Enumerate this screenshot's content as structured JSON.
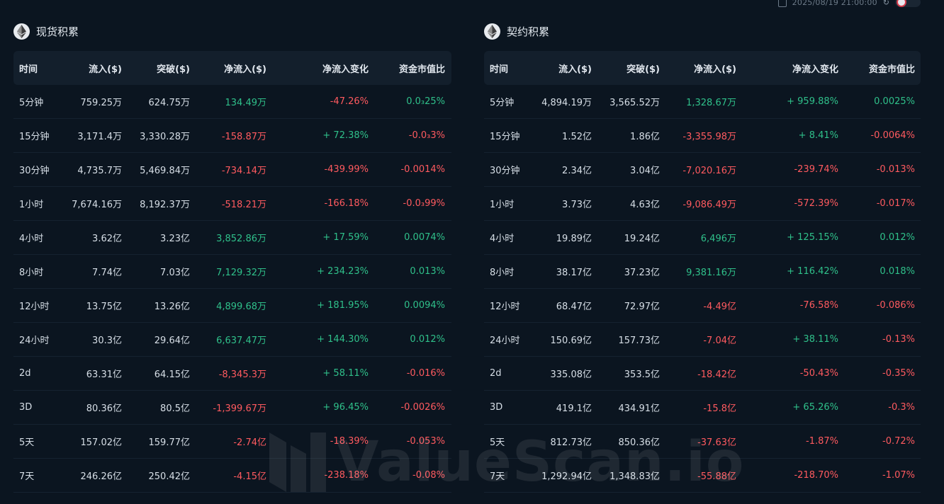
{
  "topbar": {
    "timestamp": "2025/08/19 21:00:00"
  },
  "spot": {
    "title": "现货积累",
    "headers": [
      "时间",
      "流入($)",
      "突破($)",
      "净流入($)",
      "净流入变化",
      "资金市值比"
    ],
    "rows": [
      [
        "5分钟",
        "759.25万",
        "624.75万",
        "134.49万",
        "-47.26%",
        "0.0₃25%"
      ],
      [
        "15分钟",
        "3,171.4万",
        "3,330.28万",
        "-158.87万",
        "+ 72.38%",
        "-0.0₃3%"
      ],
      [
        "30分钟",
        "4,735.7万",
        "5,469.84万",
        "-734.14万",
        "-439.99%",
        "-0.0014%"
      ],
      [
        "1小时",
        "7,674.16万",
        "8,192.37万",
        "-518.21万",
        "-166.18%",
        "-0.0₃99%"
      ],
      [
        "4小时",
        "3.62亿",
        "3.23亿",
        "3,852.86万",
        "+ 17.59%",
        "0.0074%"
      ],
      [
        "8小时",
        "7.74亿",
        "7.03亿",
        "7,129.32万",
        "+ 234.23%",
        "0.013%"
      ],
      [
        "12小时",
        "13.75亿",
        "13.26亿",
        "4,899.68万",
        "+ 181.95%",
        "0.0094%"
      ],
      [
        "24小时",
        "30.3亿",
        "29.64亿",
        "6,637.47万",
        "+ 144.30%",
        "0.012%"
      ],
      [
        "2d",
        "63.31亿",
        "64.15亿",
        "-8,345.3万",
        "+ 58.11%",
        "-0.016%"
      ],
      [
        "3D",
        "80.36亿",
        "80.5亿",
        "-1,399.67万",
        "+ 96.45%",
        "-0.0026%"
      ],
      [
        "5天",
        "157.02亿",
        "159.77亿",
        "-2.74亿",
        "-18.39%",
        "-0.053%"
      ],
      [
        "7天",
        "246.26亿",
        "250.42亿",
        "-4.15亿",
        "-238.18%",
        "-0.08%"
      ]
    ]
  },
  "futures": {
    "title": "契约积累",
    "headers": [
      "时间",
      "流入($)",
      "突破($)",
      "净流入($)",
      "净流入变化",
      "资金市值比"
    ],
    "rows": [
      [
        "5分钟",
        "4,894.19万",
        "3,565.52万",
        "1,328.67万",
        "+ 959.88%",
        "0.0025%"
      ],
      [
        "15分钟",
        "1.52亿",
        "1.86亿",
        "-3,355.98万",
        "+ 8.41%",
        "-0.0064%"
      ],
      [
        "30分钟",
        "2.34亿",
        "3.04亿",
        "-7,020.16万",
        "-239.74%",
        "-0.013%"
      ],
      [
        "1小时",
        "3.73亿",
        "4.63亿",
        "-9,086.49万",
        "-572.39%",
        "-0.017%"
      ],
      [
        "4小时",
        "19.89亿",
        "19.24亿",
        "6,496万",
        "+ 125.15%",
        "0.012%"
      ],
      [
        "8小时",
        "38.17亿",
        "37.23亿",
        "9,381.16万",
        "+ 116.42%",
        "0.018%"
      ],
      [
        "12小时",
        "68.47亿",
        "72.97亿",
        "-4.49亿",
        "-76.58%",
        "-0.086%"
      ],
      [
        "24小时",
        "150.69亿",
        "157.73亿",
        "-7.04亿",
        "+ 38.11%",
        "-0.13%"
      ],
      [
        "2d",
        "335.08亿",
        "353.5亿",
        "-18.42亿",
        "-50.43%",
        "-0.35%"
      ],
      [
        "3D",
        "419.1亿",
        "434.91亿",
        "-15.8亿",
        "+ 65.26%",
        "-0.3%"
      ],
      [
        "5天",
        "812.73亿",
        "850.36亿",
        "-37.63亿",
        "-1.87%",
        "-0.72%"
      ],
      [
        "7天",
        "1,292.94亿",
        "1,348.83亿",
        "-55.88亿",
        "-218.70%",
        "-1.07%"
      ]
    ]
  },
  "watermark": {
    "text": "ValueScan.io"
  },
  "colors": {
    "positive": "#2fc08a",
    "negative": "#ff5a5f",
    "background": "#0b1520",
    "header_bg": "#131f2c"
  },
  "icons": {
    "panel": "ethereum-icon",
    "topbar": [
      "copy-icon",
      "refresh-icon",
      "toggle-switch"
    ]
  }
}
